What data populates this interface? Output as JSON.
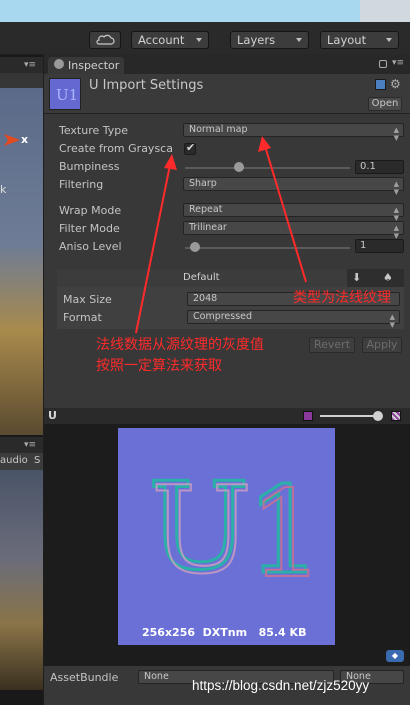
{
  "toolbar": {
    "account_label": "Account",
    "layers_label": "Layers",
    "layout_label": "Layout"
  },
  "scene": {
    "axis_label": "x",
    "side_label": "k",
    "tabs": [
      "audio",
      "S"
    ]
  },
  "inspector": {
    "tab_label": "Inspector",
    "title": "U Import Settings",
    "thumb_letters": "U1",
    "open_label": "Open",
    "fields": {
      "texture_type": {
        "label": "Texture Type",
        "value": "Normal map"
      },
      "create_from_grayscale": {
        "label": "Create from Graysca",
        "checked": true
      },
      "bumpiness": {
        "label": "Bumpiness",
        "value": "0.1",
        "slider_fraction": 0.32
      },
      "filtering": {
        "label": "Filtering",
        "value": "Sharp"
      },
      "wrap_mode": {
        "label": "Wrap Mode",
        "value": "Repeat"
      },
      "filter_mode": {
        "label": "Filter Mode",
        "value": "Trilinear"
      },
      "aniso_level": {
        "label": "Aniso Level",
        "value": "1",
        "slider_fraction": 0.08
      }
    },
    "platform": {
      "default_label": "Default",
      "max_size": {
        "label": "Max Size",
        "value": "2048"
      },
      "format": {
        "label": "Format",
        "value": "Compressed"
      }
    },
    "revert_label": "Revert",
    "apply_label": "Apply",
    "preview": {
      "name": "U",
      "info": "256x256  DXTnm   85.4 KB",
      "letters": "U1"
    },
    "assetbundle": {
      "label": "AssetBundle",
      "value": "None",
      "variant": "None"
    }
  },
  "annotations": {
    "type_note": "类型为法线纹理",
    "grayscale_note_line1": "法线数据从源纹理的灰度值",
    "grayscale_note_line2": "按照一定算法来获取"
  },
  "watermark": "https://blog.csdn.net/zjz520yy",
  "colors": {
    "annotation": "#ff2a2a",
    "normal_map_bg": "#6a70d6"
  }
}
